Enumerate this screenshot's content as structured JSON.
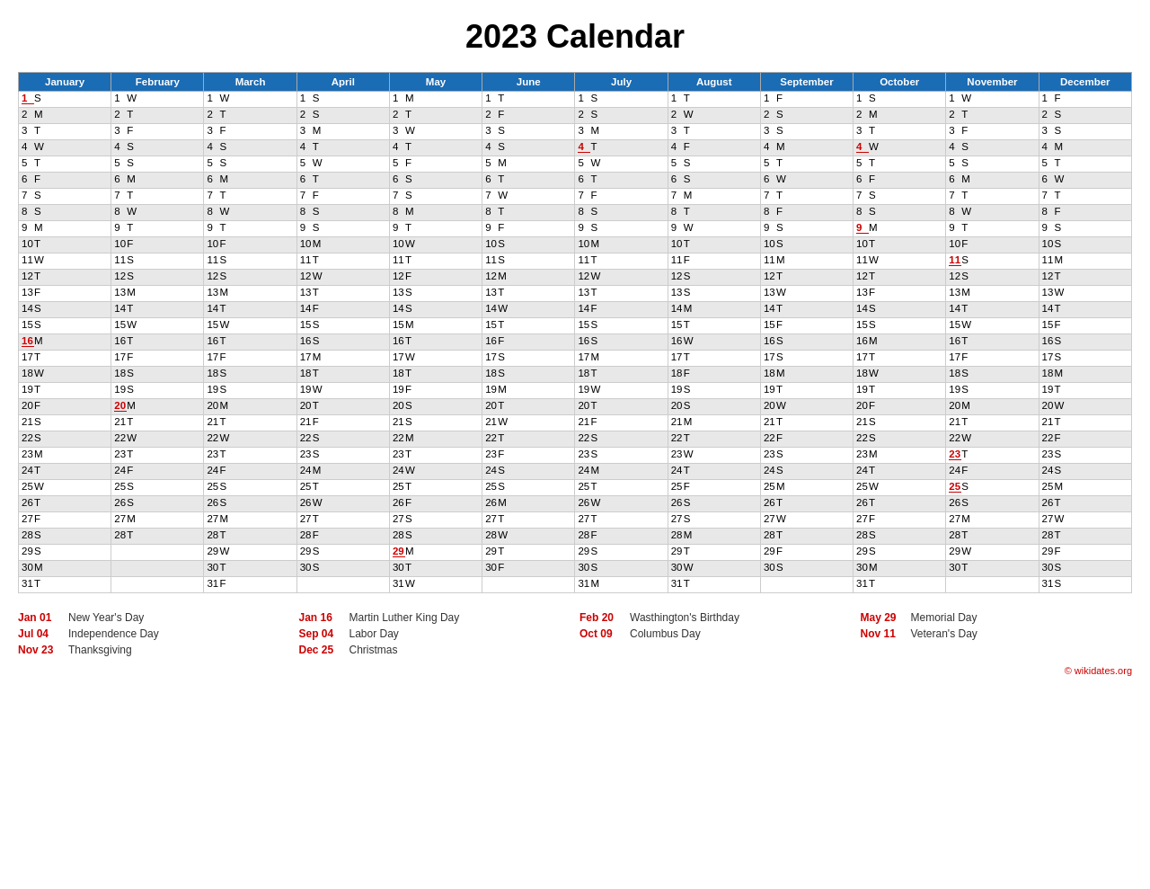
{
  "title": "2023 Calendar",
  "months": [
    "January",
    "February",
    "March",
    "April",
    "May",
    "June",
    "July",
    "August",
    "September",
    "October",
    "November",
    "December"
  ],
  "rows": [
    [
      "1 S",
      "1 W",
      "1 W",
      "1 S",
      "1 M",
      "1 T",
      "1 S",
      "1 T",
      "1 F",
      "1 S",
      "1 W",
      "1 F"
    ],
    [
      "2 M",
      "2 T",
      "2 T",
      "2 S",
      "2 T",
      "2 F",
      "2 S",
      "2 W",
      "2 S",
      "2 M",
      "2 T",
      "2 S"
    ],
    [
      "3 T",
      "3 F",
      "3 F",
      "3 M",
      "3 W",
      "3 S",
      "3 M",
      "3 T",
      "3 S",
      "3 T",
      "3 F",
      "3 S"
    ],
    [
      "4 W",
      "4 S",
      "4 S",
      "4 T",
      "4 T",
      "4 S",
      "4 T",
      "4 F",
      "4 M",
      "4 W",
      "4 S",
      "4 M"
    ],
    [
      "5 T",
      "5 S",
      "5 S",
      "5 W",
      "5 F",
      "5 M",
      "5 W",
      "5 S",
      "5 T",
      "5 T",
      "5 S",
      "5 T"
    ],
    [
      "6 F",
      "6 M",
      "6 M",
      "6 T",
      "6 S",
      "6 T",
      "6 T",
      "6 S",
      "6 W",
      "6 F",
      "6 M",
      "6 W"
    ],
    [
      "7 S",
      "7 T",
      "7 T",
      "7 F",
      "7 S",
      "7 W",
      "7 F",
      "7 M",
      "7 T",
      "7 S",
      "7 T",
      "7 T"
    ],
    [
      "8 S",
      "8 W",
      "8 W",
      "8 S",
      "8 M",
      "8 T",
      "8 S",
      "8 T",
      "8 F",
      "8 S",
      "8 W",
      "8 F"
    ],
    [
      "9 M",
      "9 T",
      "9 T",
      "9 S",
      "9 T",
      "9 F",
      "9 S",
      "9 W",
      "9 S",
      "9 M",
      "9 T",
      "9 S"
    ],
    [
      "10 T",
      "10 F",
      "10 F",
      "10 M",
      "10 W",
      "10 S",
      "10 M",
      "10 T",
      "10 S",
      "10 T",
      "10 F",
      "10 S"
    ],
    [
      "11 W",
      "11 S",
      "11 S",
      "11 T",
      "11 T",
      "11 S",
      "11 T",
      "11 F",
      "11 M",
      "11 W",
      "11 S",
      "11 M"
    ],
    [
      "12 T",
      "12 S",
      "12 S",
      "12 W",
      "12 F",
      "12 M",
      "12 W",
      "12 S",
      "12 T",
      "12 T",
      "12 S",
      "12 T"
    ],
    [
      "13 F",
      "13 M",
      "13 M",
      "13 T",
      "13 S",
      "13 T",
      "13 T",
      "13 S",
      "13 W",
      "13 F",
      "13 M",
      "13 W"
    ],
    [
      "14 S",
      "14 T",
      "14 T",
      "14 F",
      "14 S",
      "14 W",
      "14 F",
      "14 M",
      "14 T",
      "14 S",
      "14 T",
      "14 T"
    ],
    [
      "15 S",
      "15 W",
      "15 W",
      "15 S",
      "15 M",
      "15 T",
      "15 S",
      "15 T",
      "15 F",
      "15 S",
      "15 W",
      "15 F"
    ],
    [
      "16 M",
      "16 T",
      "16 T",
      "16 S",
      "16 T",
      "16 F",
      "16 S",
      "16 W",
      "16 S",
      "16 M",
      "16 T",
      "16 S"
    ],
    [
      "17 T",
      "17 F",
      "17 F",
      "17 M",
      "17 W",
      "17 S",
      "17 M",
      "17 T",
      "17 S",
      "17 T",
      "17 F",
      "17 S"
    ],
    [
      "18 W",
      "18 S",
      "18 S",
      "18 T",
      "18 T",
      "18 S",
      "18 T",
      "18 F",
      "18 M",
      "18 W",
      "18 S",
      "18 M"
    ],
    [
      "19 T",
      "19 S",
      "19 S",
      "19 W",
      "19 F",
      "19 M",
      "19 W",
      "19 S",
      "19 T",
      "19 T",
      "19 S",
      "19 T"
    ],
    [
      "20 F",
      "20 M",
      "20 M",
      "20 T",
      "20 S",
      "20 T",
      "20 T",
      "20 S",
      "20 W",
      "20 F",
      "20 M",
      "20 W"
    ],
    [
      "21 S",
      "21 T",
      "21 T",
      "21 F",
      "21 S",
      "21 W",
      "21 F",
      "21 M",
      "21 T",
      "21 S",
      "21 T",
      "21 T"
    ],
    [
      "22 S",
      "22 W",
      "22 W",
      "22 S",
      "22 M",
      "22 T",
      "22 S",
      "22 T",
      "22 F",
      "22 S",
      "22 W",
      "22 F"
    ],
    [
      "23 M",
      "23 T",
      "23 T",
      "23 S",
      "23 T",
      "23 F",
      "23 S",
      "23 W",
      "23 S",
      "23 M",
      "23 T",
      "23 S"
    ],
    [
      "24 T",
      "24 F",
      "24 F",
      "24 M",
      "24 W",
      "24 S",
      "24 M",
      "24 T",
      "24 S",
      "24 T",
      "24 F",
      "24 S"
    ],
    [
      "25 W",
      "25 S",
      "25 S",
      "25 T",
      "25 T",
      "25 S",
      "25 T",
      "25 F",
      "25 M",
      "25 W",
      "25 S",
      "25 M"
    ],
    [
      "26 T",
      "26 S",
      "26 S",
      "26 W",
      "26 F",
      "26 M",
      "26 W",
      "26 S",
      "26 T",
      "26 T",
      "26 S",
      "26 T"
    ],
    [
      "27 F",
      "27 M",
      "27 M",
      "27 T",
      "27 S",
      "27 T",
      "27 T",
      "27 S",
      "27 W",
      "27 F",
      "27 M",
      "27 W"
    ],
    [
      "28 S",
      "28 T",
      "28 T",
      "28 F",
      "28 S",
      "28 W",
      "28 F",
      "28 M",
      "28 T",
      "28 S",
      "28 T",
      "28 T"
    ],
    [
      "29 S",
      "",
      "29 W",
      "29 S",
      "29 M",
      "29 T",
      "29 S",
      "29 T",
      "29 F",
      "29 S",
      "29 W",
      "29 F"
    ],
    [
      "30 M",
      "",
      "30 T",
      "30 S",
      "30 T",
      "30 F",
      "30 S",
      "30 W",
      "30 S",
      "30 M",
      "30 T",
      "30 S"
    ],
    [
      "31 T",
      "",
      "31 F",
      "",
      "31 W",
      "",
      "31 M",
      "31 T",
      "",
      "31 T",
      "",
      "31 S"
    ]
  ],
  "red_cells": {
    "0-0": true,
    "15-0": true,
    "3-6": true,
    "3-9": true,
    "10-10": true,
    "22-10": true,
    "19-1": true,
    "28-4": true,
    "24-10": true,
    "8-9": true
  },
  "gray_rows": [
    1,
    3,
    5,
    7,
    9,
    11,
    13,
    15,
    17,
    19,
    21,
    23,
    25,
    27,
    29
  ],
  "holidays": [
    {
      "date": "Jan 01",
      "name": "New Year's Day"
    },
    {
      "date": "Jan 16",
      "name": "Martin Luther King Day"
    },
    {
      "date": "Feb 20",
      "name": "Wasthington's Birthday"
    },
    {
      "date": "May 29",
      "name": "Memorial Day"
    },
    {
      "date": "Jul 04",
      "name": "Independence Day"
    },
    {
      "date": "Sep 04",
      "name": "Labor Day"
    },
    {
      "date": "Oct 09",
      "name": "Columbus Day"
    },
    {
      "date": "Nov 11",
      "name": "Veteran's Day"
    },
    {
      "date": "Nov 23",
      "name": "Thanksgiving"
    },
    {
      "date": "Dec 25",
      "name": "Christmas"
    }
  ],
  "footer": "© wikidates.org"
}
